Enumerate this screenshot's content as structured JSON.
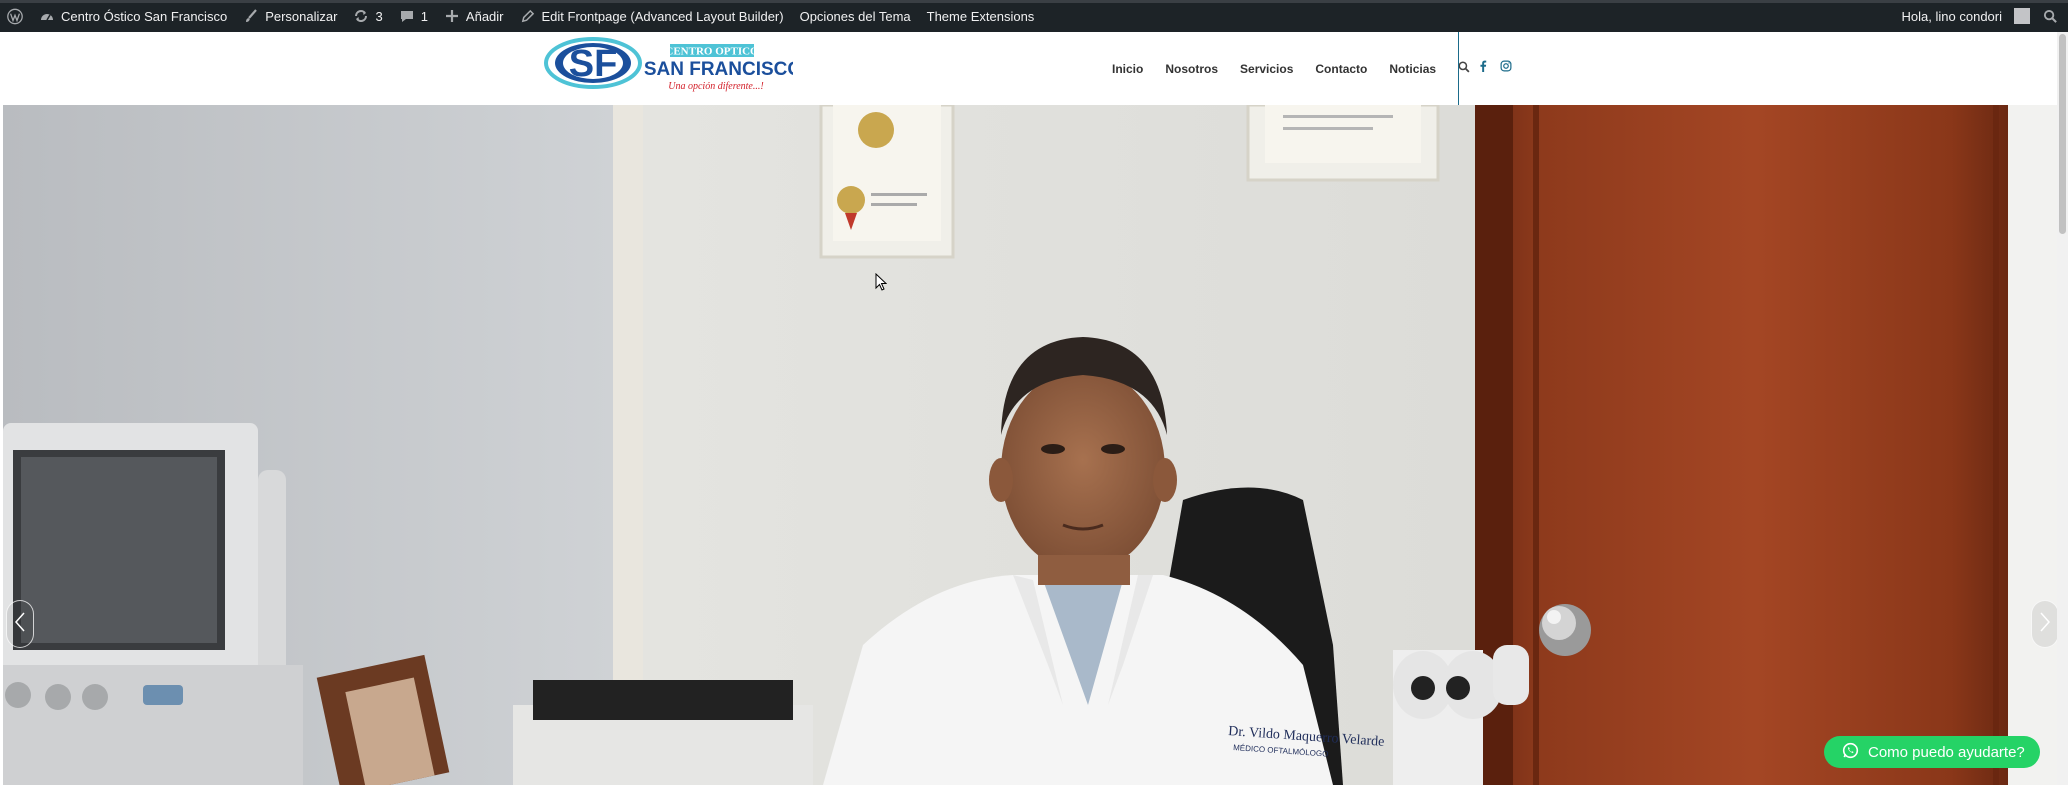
{
  "admin_bar": {
    "site_name": "Centro Óstico San Francisco",
    "customize": "Personalizar",
    "updates_count": "3",
    "comments_count": "1",
    "add_new": "Añadir",
    "edit_frontpage": "Edit Frontpage (Advanced Layout Builder)",
    "theme_options": "Opciones del Tema",
    "theme_extensions": "Theme Extensions",
    "greeting": "Hola, lino condori"
  },
  "logo": {
    "badge": "CENTRO OPTICO",
    "name": "SAN FRANCISCO",
    "tagline": "Una opción diferente...!",
    "monogram": "SF"
  },
  "nav": {
    "items": [
      "Inicio",
      "Nosotros",
      "Servicios",
      "Contacto",
      "Noticias"
    ]
  },
  "hero": {
    "coat_text_line1": "Dr. Vildo Maquerro Velarde",
    "coat_text_line2": "MÉDICO OFTALMÓLOGO"
  },
  "whatsapp": {
    "label": "Como puedo ayudarte?"
  },
  "colors": {
    "admin_bar_bg": "#1d2327",
    "brand_blue": "#1b4f9c",
    "brand_cyan": "#4ec3d6",
    "brand_red": "#d3202a",
    "whatsapp_green": "#25d366"
  }
}
